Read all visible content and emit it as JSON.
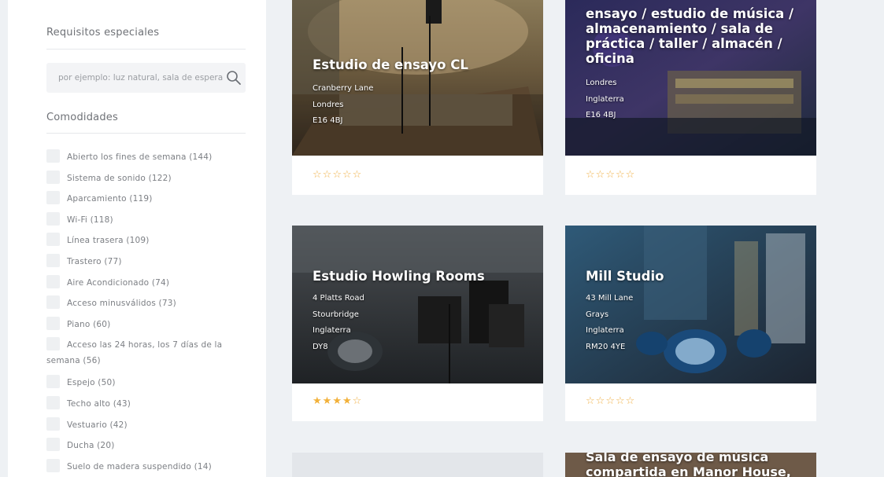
{
  "filters": {
    "special_requirements": {
      "label": "Requisitos especiales",
      "placeholder": "por ejemplo: luz natural, sala de espera"
    },
    "amenities": {
      "label": "Comodidades",
      "items": [
        "Abierto los fines de semana (144)",
        "Sistema de sonido (122)",
        "Aparcamiento (119)",
        "Wi-Fi (118)",
        "Línea trasera (109)",
        "Trastero (77)",
        "Aire Acondicionado (74)",
        "Acceso minusválidos (73)",
        "Piano (60)",
        "Espejo (50)",
        "Techo alto (43)",
        "Vestuario (42)",
        "Ducha (20)",
        "Suelo de madera suspendido (14)"
      ],
      "multiline_item": {
        "line1": "Acceso las 24 horas, los 7 días de la",
        "line2": "semana (56)"
      }
    }
  },
  "listings": [
    {
      "title": "Estudio de ensayo CL",
      "lines": [
        "Cranberry Lane",
        "Londres",
        "E16 4BJ"
      ],
      "rating": 0
    },
    {
      "title": "ensayo / estudio de música / almacenamiento / sala de práctica / taller / almacén / oficina",
      "lines": [
        "Londres",
        "Inglaterra",
        "E16 4BJ"
      ],
      "rating": 0
    },
    {
      "title": "Estudio Howling Rooms",
      "lines": [
        "4 Platts Road",
        "Stourbridge",
        "Inglaterra",
        "DY8"
      ],
      "rating": 4
    },
    {
      "title": "Mill Studio",
      "lines": [
        "43 Mill Lane",
        "Grays",
        "Inglaterra",
        "RM20 4YE"
      ],
      "rating": 0
    },
    {
      "title": "Sala de ensayo de música compartida en Manor House,",
      "lines": [],
      "rating": 0
    }
  ],
  "colors": {
    "page_bg": "#eef1f4",
    "star": "#f2b13a",
    "muted_text": "#7c7f84"
  }
}
